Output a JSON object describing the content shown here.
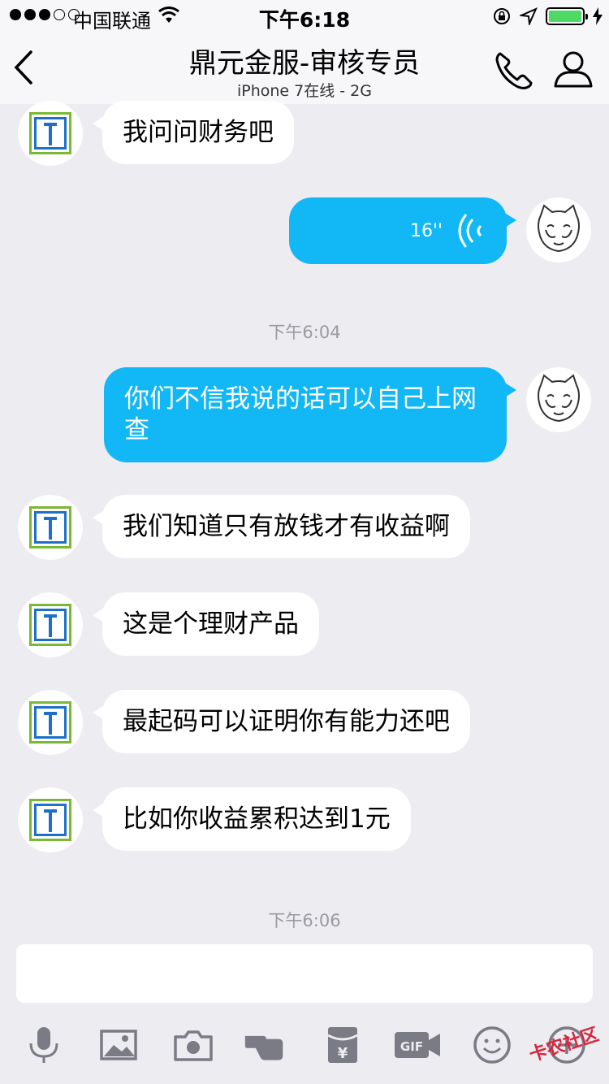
{
  "status_bar": {
    "carrier": "中国联通",
    "time": "下午6:18"
  },
  "nav": {
    "title": "鼎元金服-审核专员",
    "subtitle": "iPhone 7在线 - 2G"
  },
  "messages": {
    "m1": "我问问财务吧",
    "voice_duration": "16''",
    "ts1": "下午6:04",
    "m2_line1": "你们不信我说的话可以自己上网",
    "m2_line2": "查",
    "m3": "我们知道只有放钱才有收益啊",
    "m4": "这是个理财产品",
    "m5": "最起码可以证明你有能力还吧",
    "m6": "比如你收益累积达到1元",
    "ts2": "下午6:06"
  },
  "input": {
    "value": ""
  },
  "watermark": "卡农社区",
  "colors": {
    "outgoing_bubble": "#12b7f5",
    "incoming_bubble": "#ffffff",
    "background": "#ececf1"
  },
  "icons": [
    "back-icon",
    "phone-icon",
    "user-icon",
    "mic-icon",
    "image-icon",
    "camera-icon",
    "poke-icon",
    "red-packet-icon",
    "gif-icon",
    "emoji-icon",
    "plus-icon"
  ]
}
